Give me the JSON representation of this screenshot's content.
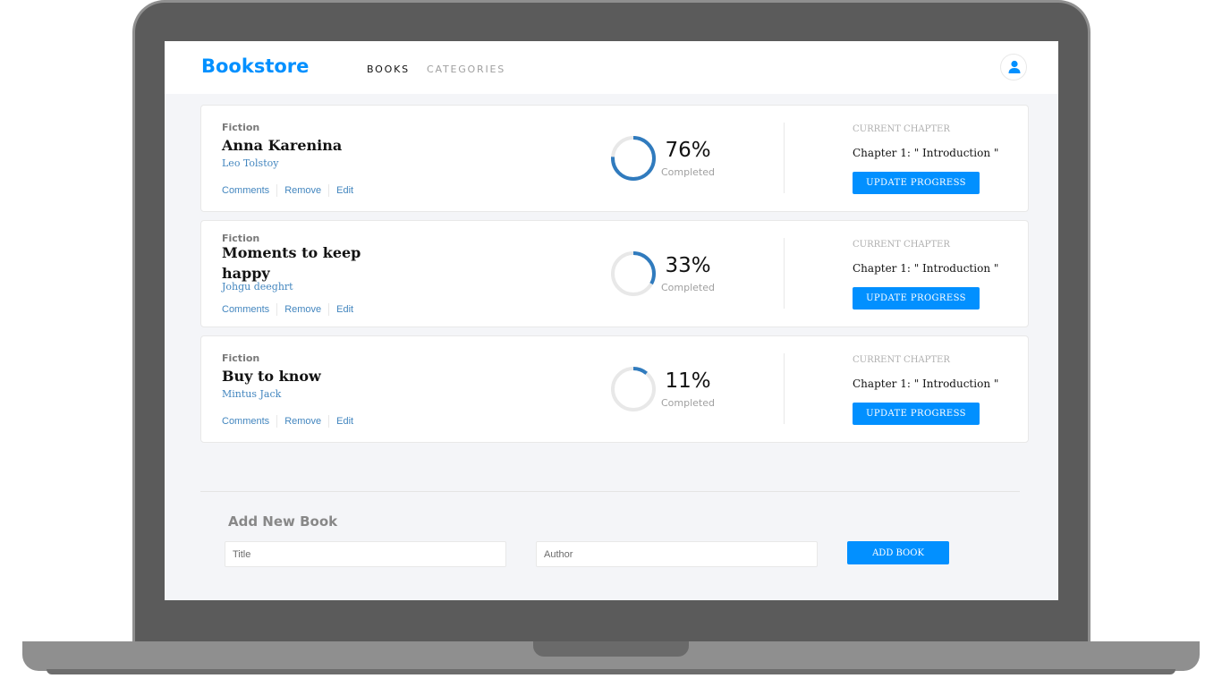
{
  "header": {
    "logo": "Bookstore",
    "nav": [
      "BOOKS",
      "CATEGORIES"
    ]
  },
  "books": [
    {
      "genre": "Fiction",
      "title": "Anna Karenina",
      "author": "Leo Tolstoy",
      "actions": [
        "Comments",
        "Remove",
        "Edit"
      ],
      "progress": 76,
      "percent_label": "76%",
      "completed_label": "Completed",
      "chapter_label": "CURRENT CHAPTER",
      "chapter": "Chapter 1: \" Introduction \"",
      "button": "UPDATE PROGRESS"
    },
    {
      "genre": "Fiction",
      "title": "Moments to keep happy",
      "author": "Johgu deeghrt",
      "actions": [
        "Comments",
        "Remove",
        "Edit"
      ],
      "progress": 33,
      "percent_label": "33%",
      "completed_label": "Completed",
      "chapter_label": "CURRENT CHAPTER",
      "chapter": "Chapter 1: \" Introduction \"",
      "button": "UPDATE PROGRESS"
    },
    {
      "genre": "Fiction",
      "title": "Buy to know",
      "author": "Mintus Jack",
      "actions": [
        "Comments",
        "Remove",
        "Edit"
      ],
      "progress": 11,
      "percent_label": "11%",
      "completed_label": "Completed",
      "chapter_label": "CURRENT CHAPTER",
      "chapter": "Chapter 1: \" Introduction \"",
      "button": "UPDATE PROGRESS"
    }
  ],
  "add_form": {
    "title": "Add New Book",
    "title_placeholder": "Title",
    "author_placeholder": "Author",
    "button": "ADD BOOK"
  },
  "colors": {
    "accent": "#0290ff",
    "ring_fill": "#307bbe",
    "ring_track": "#e8e8e8",
    "link": "#4386bf"
  }
}
